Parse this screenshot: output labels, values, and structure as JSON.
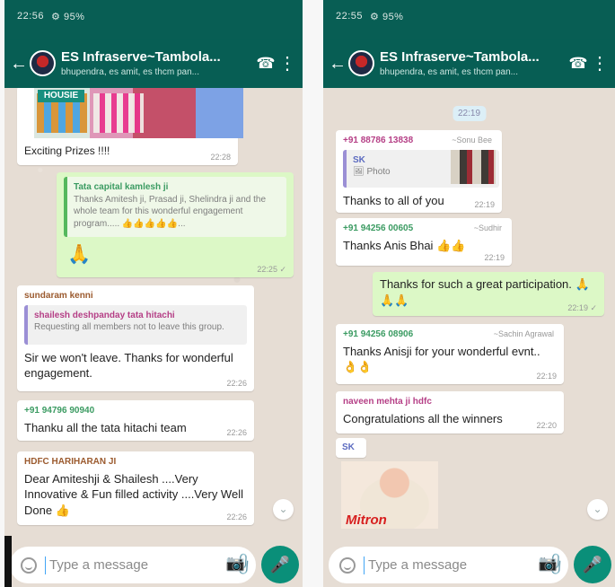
{
  "left": {
    "status": {
      "time": "22:56",
      "signal": "⚙ 95%"
    },
    "chat_title": "ES Infraserve~Tambola...",
    "chat_subtitle": "bhupendra, es amit, es thcm pan...",
    "messages": {
      "m1_text": "Exciting Prizes !!!!",
      "m1_time": "22:28",
      "m2_quote_name": "Tata capital kamlesh ji",
      "m2_quote_text": "Thanks Amitesh ji, Prasad ji, Shelindra ji and the whole team for this wonderful engagement program..... 👍👍👍👍👍...",
      "m2_text": "🙏",
      "m2_time": "22:25 ✓",
      "m3_sender": "sundaram kenni",
      "m3_quote_name": "shailesh deshpanday tata hitachi",
      "m3_quote_text": "Requesting all members not to leave this group.",
      "m3_text": "Sir we won't leave. Thanks for wonderful engagement.",
      "m3_time": "22:26",
      "m4_sender": "+91 94796 90940",
      "m4_text": "Thanku all the tata hitachi team",
      "m4_time": "22:26",
      "m5_sender": "HDFC HARIHARAN JI",
      "m5_text": "Dear Amiteshji & Shailesh ....Very Innovative & Fun filled activity ....Very Well Done 👍",
      "m5_time": "22:26"
    },
    "composer_placeholder": "Type a message"
  },
  "right": {
    "status": {
      "time": "22:55",
      "signal": "⚙ 95%"
    },
    "chat_title": "ES Infraserve~Tambola...",
    "chat_subtitle": "bhupendra, es amit, es thcm pan...",
    "date_chip": "22:19",
    "messages": {
      "r1_sender": "+91 88786 13838",
      "r1_alias": "~Sonu Bee",
      "r1_quote_name": "SK",
      "r1_quote_text": "🖼 Photo",
      "r1_text": "Thanks to all of you",
      "r1_time": "22:19",
      "r2_sender": "+91 94256 00605",
      "r2_alias": "~Sudhir",
      "r2_text": "Thanks Anis Bhai 👍👍",
      "r2_time": "22:19",
      "r3_text": "Thanks for such a great participation. 🙏🙏🙏",
      "r3_time": "22:19 ✓",
      "r4_sender": "+91 94256 08906",
      "r4_alias": "~Sachin Agrawal",
      "r4_text": "Thanks Anisji for your wonderful evnt.. 👌👌",
      "r4_time": "22:19",
      "r5_sender": "naveen mehta ji hdfc",
      "r5_text": "Congratulations all the winners",
      "r5_time": "22:20",
      "r6_sender": "SK",
      "sticker_caption": "Mitron"
    },
    "composer_placeholder": "Type a message"
  },
  "icons": {
    "back": "←",
    "call": "☎",
    "menu": "⋮",
    "down": "⌄",
    "attach": "📎",
    "camera": "📷",
    "mic": "🎤"
  },
  "colors": {
    "header": "#075e54",
    "chat_bg": "#e6ddd4",
    "outgoing": "#dcf8c6",
    "incoming": "#ffffff",
    "mic": "#0a8f79"
  }
}
